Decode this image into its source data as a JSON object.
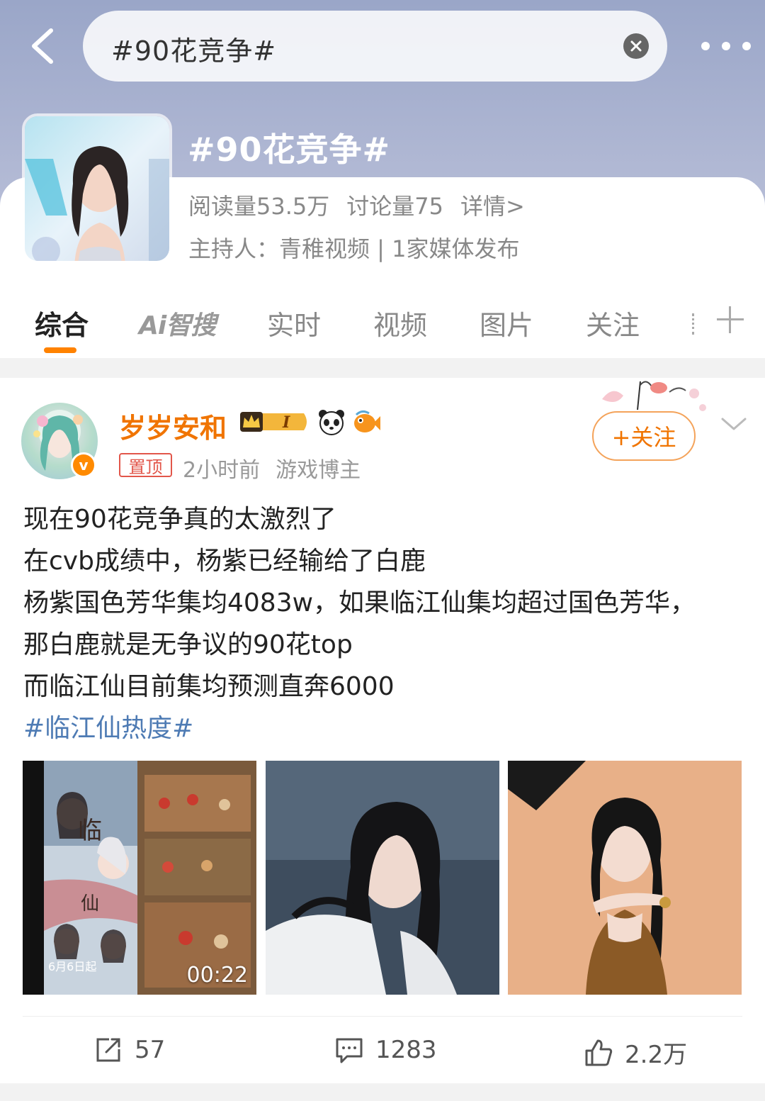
{
  "search": {
    "query": "#90花竞争#"
  },
  "topic": {
    "title": "#90花竞争#",
    "reads": "阅读量53.5万",
    "discussions": "讨论量75",
    "details": "详情>",
    "host": "主持人：青稚视频 | 1家媒体发布"
  },
  "tabs": [
    "综合",
    "Ai智搜",
    "实时",
    "视频",
    "图片",
    "关注"
  ],
  "post": {
    "username": "岁岁安和",
    "level_badge": "I",
    "pinned": "置顶",
    "time": "2小时前",
    "role": "游戏博主",
    "follow_label": "+关注",
    "lines": [
      "现在90花竞争真的太激烈了",
      "在cvb成绩中，杨紫已经输给了白鹿",
      "杨紫国色芳华集均4083w，如果临江仙集均超过国色芳华，",
      "那白鹿就是无争议的90花top",
      "而临江仙目前集均预测直奔6000"
    ],
    "hashtag": "#临江仙热度#",
    "video_duration": "00:22",
    "video_date": "6月6日起",
    "reposts": "57",
    "comments": "1283",
    "likes": "2.2万"
  },
  "colors": {
    "accent": "#ff8200",
    "username": "#f07400",
    "hashtag": "#4e7bb4"
  }
}
